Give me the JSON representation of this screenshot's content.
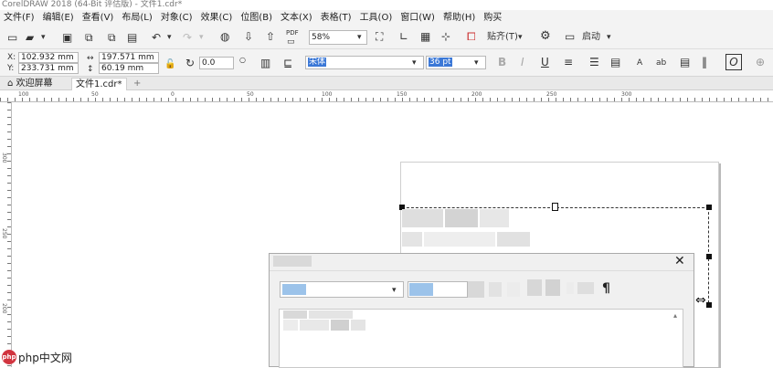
{
  "app": {
    "title": "CorelDRAW 2018 (64-Bit 评估版) - 文件1.cdr*"
  },
  "menu": [
    "文件(F)",
    "编辑(E)",
    "查看(V)",
    "布局(L)",
    "对象(C)",
    "效果(C)",
    "位图(B)",
    "文本(X)",
    "表格(T)",
    "工具(O)",
    "窗口(W)",
    "帮助(H)",
    "购买"
  ],
  "toolbar": {
    "zoom": "58%",
    "snap_label": "贴齐(T)",
    "launch_label": "启动",
    "pdf_label": "PDF"
  },
  "properties": {
    "x": "102.932 mm",
    "y": "233.731 mm",
    "x_label": "X:",
    "y_label": "Y:",
    "width": "197.571 mm",
    "height": "60.19 mm",
    "rotation": "0.0",
    "font_name": "宋体",
    "font_size": "36 pt",
    "bold": "B",
    "italic": "I",
    "underline": "U"
  },
  "tabs": {
    "welcome": "欢迎屏幕",
    "document": "文件1.cdr*"
  },
  "ruler": {
    "h": [
      "100",
      "50",
      "0",
      "50",
      "100",
      "150",
      "200",
      "250",
      "300"
    ],
    "v": [
      "300",
      "250",
      "200"
    ]
  },
  "dialog": {
    "paragraph_icon": "¶"
  },
  "watermark": {
    "text": "php中文网"
  }
}
